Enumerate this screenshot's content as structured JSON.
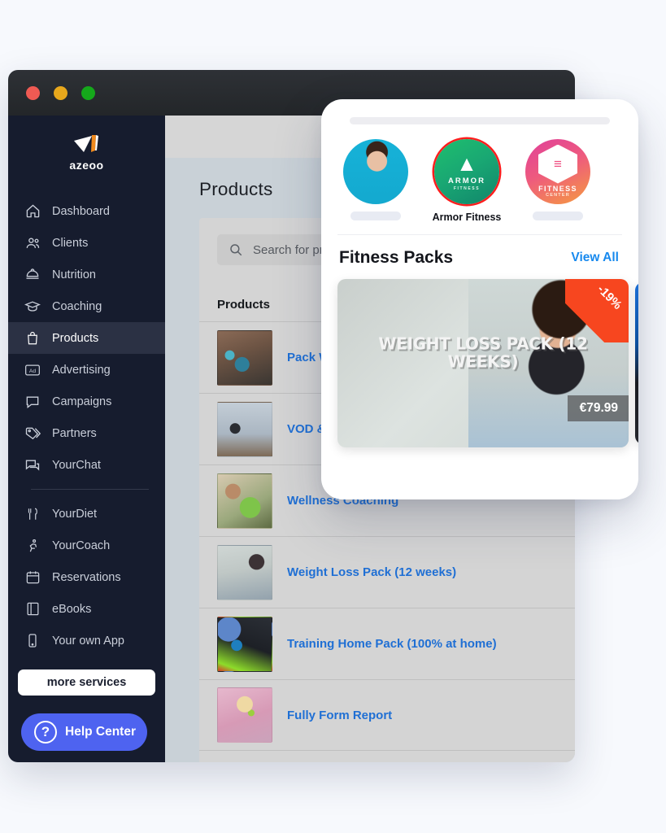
{
  "window": {
    "traffic_lights": [
      "close",
      "minimize",
      "maximize"
    ]
  },
  "sidebar": {
    "brand": "azeoo",
    "items": [
      {
        "label": "Dashboard",
        "icon": "home-icon",
        "active": false
      },
      {
        "label": "Clients",
        "icon": "people-icon",
        "active": false
      },
      {
        "label": "Nutrition",
        "icon": "nutrition-icon",
        "active": false
      },
      {
        "label": "Coaching",
        "icon": "graduation-icon",
        "active": false
      },
      {
        "label": "Products",
        "icon": "shopping-bag-icon",
        "active": true
      },
      {
        "label": "Advertising",
        "icon": "ad-icon",
        "active": false
      },
      {
        "label": "Campaigns",
        "icon": "speech-bubble-icon",
        "active": false
      },
      {
        "label": "Partners",
        "icon": "tag-icon",
        "active": false
      },
      {
        "label": "YourChat",
        "icon": "chat-icon",
        "active": false
      }
    ],
    "items_secondary": [
      {
        "label": "YourDiet",
        "icon": "cutlery-icon"
      },
      {
        "label": "YourCoach",
        "icon": "runner-icon"
      },
      {
        "label": "Reservations",
        "icon": "calendar-icon"
      },
      {
        "label": "eBooks",
        "icon": "book-icon"
      },
      {
        "label": "Your own App",
        "icon": "mobile-icon"
      }
    ],
    "more_services_label": "more services",
    "help_center_label": "Help Center",
    "help_icon": "question-mark-icon"
  },
  "main": {
    "page_title": "Products",
    "search": {
      "placeholder": "Search for products",
      "value": "",
      "icon": "search-icon"
    },
    "list_header": "Products",
    "products": [
      {
        "name": "Pack WOD",
        "thumb": "ph-kettlebell"
      },
      {
        "name": "VOD & LIVE",
        "thumb": "ph-yoga"
      },
      {
        "name": "Wellness Coaching",
        "thumb": "ph-wellness"
      },
      {
        "name": "Weight Loss Pack (12 weeks)",
        "thumb": "ph-weight"
      },
      {
        "name": "Training Home Pack (100% at home)",
        "thumb": "ph-home"
      },
      {
        "name": "Fully Form Report",
        "thumb": "ph-report"
      }
    ]
  },
  "mobile_card": {
    "avatars": [
      {
        "label": "",
        "type": "photo",
        "ringed": false
      },
      {
        "label": "Armor Fitness",
        "type": "armor-logo",
        "ringed": true
      },
      {
        "label": "",
        "type": "fitness-center-logo",
        "ringed": false
      }
    ],
    "section_title": "Fitness Packs",
    "view_all_label": "View All",
    "featured": {
      "caption": "WEIGHT LOSS PACK (12 WEEKS)",
      "discount_badge": "-19%",
      "price": "€79.99",
      "discount_color": "#f7461f"
    }
  },
  "colors": {
    "sidebar_bg": "#161c2e",
    "sidebar_active": "#2b3144",
    "accent_blue": "#4e63f0",
    "link_blue": "#1f6fd4",
    "view_all_blue": "#1789ee",
    "page_bg": "#f7f9fd"
  }
}
